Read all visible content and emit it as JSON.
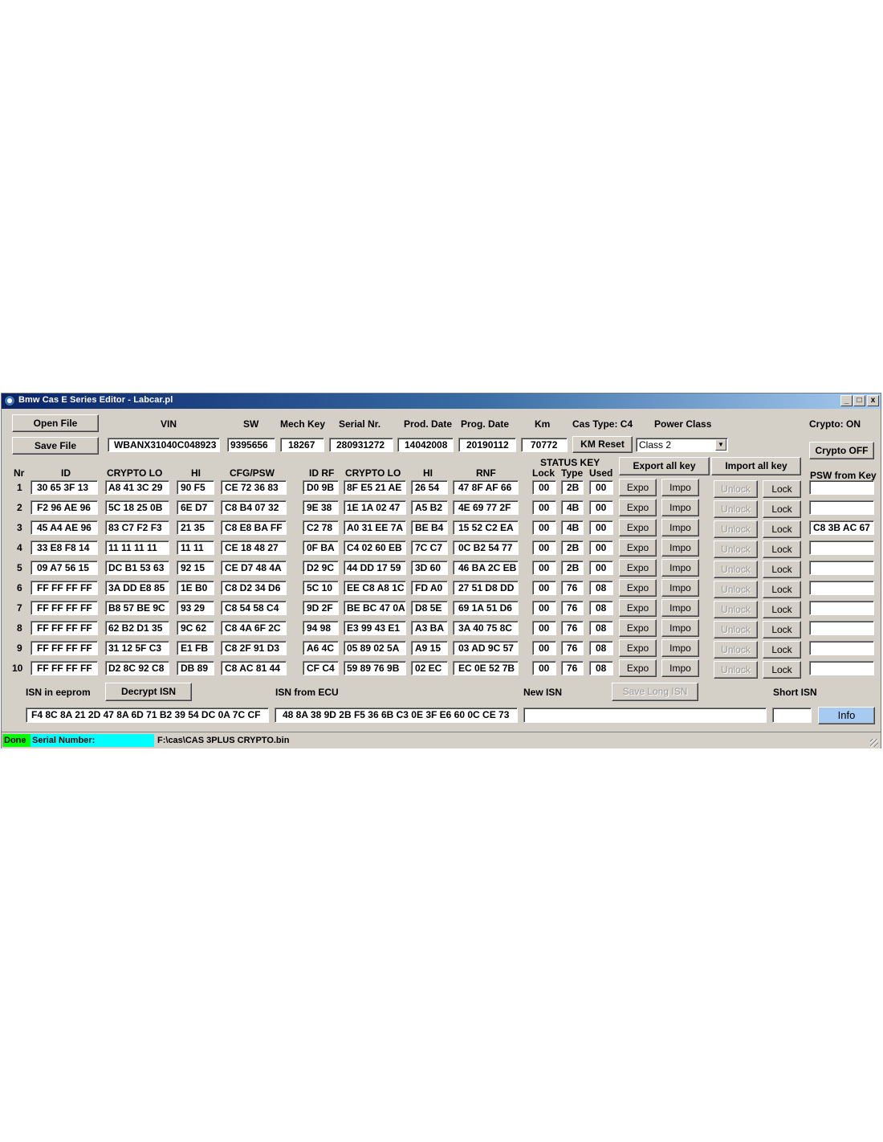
{
  "window": {
    "title": "Bmw Cas E Series Editor - Labcar.pl",
    "minimize": "_",
    "maximize": "□",
    "close": "x"
  },
  "buttons": {
    "open_file": "Open File",
    "save_file": "Save File",
    "km_reset": "KM Reset",
    "crypto_off": "Crypto OFF",
    "export_all": "Export all key",
    "import_all": "Import all key",
    "decrypt_isn": "Decrypt ISN",
    "save_long_isn": "Save Long ISN",
    "info": "Info",
    "expo": "Expo",
    "impo": "Impo",
    "unlock": "Unlock",
    "lock": "Lock"
  },
  "header": {
    "labels": {
      "vin": "VIN",
      "sw": "SW",
      "mech_key": "Mech Key",
      "serial": "Serial Nr.",
      "prod_date": "Prod. Date",
      "prog_date": "Prog. Date",
      "km": "Km",
      "cas_type": "Cas Type: C4",
      "power_class": "Power Class",
      "crypto": "Crypto: ON"
    },
    "values": {
      "vin": "WBANX31040C048923",
      "sw": "9395656",
      "mech_key": "18267",
      "serial": "280931272",
      "prod_date": "14042008",
      "prog_date": "20190112",
      "km": "70772",
      "power_class": "Class 2"
    }
  },
  "columns": {
    "nr": "Nr",
    "id": "ID",
    "crypto_lo": "CRYPTO LO",
    "hi": "HI",
    "cfg_psw": "CFG/PSW",
    "id_rf": "ID RF",
    "crypto_lo2": "CRYPTO LO",
    "hi2": "HI",
    "rnf": "RNF",
    "status_key": "STATUS KEY",
    "lock": "Lock",
    "type": "Type",
    "used": "Used",
    "psw_from_key": "PSW from Key"
  },
  "rows": [
    {
      "nr": "1",
      "id": "30 65 3F 13",
      "crypto_lo": "A8 41 3C 29",
      "hi": "90 F5",
      "cfg": "CE 72 36 83",
      "idrf": "D0 9B",
      "crypto_lo2": "8F E5 21 AE",
      "hi2": "26 54",
      "rnf": "47 8F AF 66",
      "lock": "00",
      "type": "2B",
      "used": "00",
      "psw": ""
    },
    {
      "nr": "2",
      "id": "F2 96 AE 96",
      "crypto_lo": "5C 18 25 0B",
      "hi": "6E D7",
      "cfg": "C8 B4 07 32",
      "idrf": "9E 38",
      "crypto_lo2": "1E 1A 02 47",
      "hi2": "A5 B2",
      "rnf": "4E 69 77 2F",
      "lock": "00",
      "type": "4B",
      "used": "00",
      "psw": ""
    },
    {
      "nr": "3",
      "id": "45 A4 AE 96",
      "crypto_lo": "83 C7 F2 F3",
      "hi": "21 35",
      "cfg": "C8 E8 BA FF",
      "idrf": "C2 78",
      "crypto_lo2": "A0 31 EE 7A",
      "hi2": "BE B4",
      "rnf": "15 52 C2 EA",
      "lock": "00",
      "type": "4B",
      "used": "00",
      "psw": "C8 3B AC 67"
    },
    {
      "nr": "4",
      "id": "33 E8 F8 14",
      "crypto_lo": "11 11 11 11",
      "hi": "11 11",
      "cfg": "CE 18 48 27",
      "idrf": "0F BA",
      "crypto_lo2": "C4 02 60 EB",
      "hi2": "7C C7",
      "rnf": "0C B2 54 77",
      "lock": "00",
      "type": "2B",
      "used": "00",
      "psw": ""
    },
    {
      "nr": "5",
      "id": "09 A7 56 15",
      "crypto_lo": "DC B1 53 63",
      "hi": "92 15",
      "cfg": "CE D7 48 4A",
      "idrf": "D2 9C",
      "crypto_lo2": "44 DD 17 59",
      "hi2": "3D 60",
      "rnf": "46 BA 2C EB",
      "lock": "00",
      "type": "2B",
      "used": "00",
      "psw": ""
    },
    {
      "nr": "6",
      "id": "FF FF FF FF",
      "crypto_lo": "3A DD E8 85",
      "hi": "1E B0",
      "cfg": "C8 D2 34 D6",
      "idrf": "5C 10",
      "crypto_lo2": "EE C8 A8 1C",
      "hi2": "FD A0",
      "rnf": "27 51 D8 DD",
      "lock": "00",
      "type": "76",
      "used": "08",
      "psw": ""
    },
    {
      "nr": "7",
      "id": "FF FF FF FF",
      "crypto_lo": "B8 57 BE 9C",
      "hi": "93 29",
      "cfg": "C8 54 58 C4",
      "idrf": "9D 2F",
      "crypto_lo2": "BE BC 47 0A",
      "hi2": "D8 5E",
      "rnf": "69 1A 51 D6",
      "lock": "00",
      "type": "76",
      "used": "08",
      "psw": ""
    },
    {
      "nr": "8",
      "id": "FF FF FF FF",
      "crypto_lo": "62 B2 D1 35",
      "hi": "9C 62",
      "cfg": "C8 4A 6F 2C",
      "idrf": "94 98",
      "crypto_lo2": "E3 99 43 E1",
      "hi2": "A3 BA",
      "rnf": "3A 40 75 8C",
      "lock": "00",
      "type": "76",
      "used": "08",
      "psw": ""
    },
    {
      "nr": "9",
      "id": "FF FF FF FF",
      "crypto_lo": "31 12 5F C3",
      "hi": "E1 FB",
      "cfg": "C8 2F 91 D3",
      "idrf": "A6 4C",
      "crypto_lo2": "05 89 02 5A",
      "hi2": "A9 15",
      "rnf": "03 AD 9C 57",
      "lock": "00",
      "type": "76",
      "used": "08",
      "psw": ""
    },
    {
      "nr": "10",
      "id": "FF FF FF FF",
      "crypto_lo": "D2 8C 92 C8",
      "hi": "DB 89",
      "cfg": "C8 AC 81 44",
      "idrf": "CF C4",
      "crypto_lo2": "59 89 76 9B",
      "hi2": "02 EC",
      "rnf": "EC 0E 52 7B",
      "lock": "00",
      "type": "76",
      "used": "08",
      "psw": ""
    }
  ],
  "isn": {
    "eeprom_label": "ISN in eeprom",
    "ecu_label": "ISN from ECU",
    "new_label": "New ISN",
    "short_label": "Short ISN",
    "eeprom_value": "F4 8C 8A 21 2D 47 8A 6D 71 B2 39 54 DC 0A 7C CF",
    "ecu_value": "48 8A 38 9D 2B F5 36 6B C3 0E 3F E6 60 0C CE 73",
    "new_value": "",
    "short_value": ""
  },
  "status": {
    "state": "Done",
    "serial_label": "Serial Number:",
    "file_path": "F:\\cas\\CAS 3PLUS CRYPTO.bin"
  },
  "colors": {
    "status_done": "#00ff00",
    "status_serial": "#00ffff",
    "info_button": "#a6caf0"
  }
}
